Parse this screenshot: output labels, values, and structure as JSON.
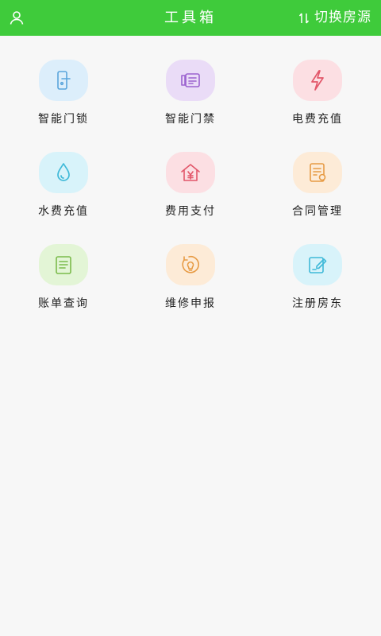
{
  "header": {
    "title": "工具箱",
    "switch_label": "切换房源",
    "background": "#3fcb3b"
  },
  "tools": [
    {
      "label": "智能门锁",
      "icon": "door-lock-icon",
      "bg": "#dceefb",
      "fg": "#5aa5dc"
    },
    {
      "label": "智能门禁",
      "icon": "access-card-icon",
      "bg": "#eadcf7",
      "fg": "#9b63cf"
    },
    {
      "label": "电费充值",
      "icon": "lightning-icon",
      "bg": "#fcdfe3",
      "fg": "#e2576a"
    },
    {
      "label": "水费充值",
      "icon": "water-drop-icon",
      "bg": "#d8f3fa",
      "fg": "#3fb9d8"
    },
    {
      "label": "费用支付",
      "icon": "house-yen-icon",
      "bg": "#fcdfe3",
      "fg": "#e2576a"
    },
    {
      "label": "合同管理",
      "icon": "contract-icon",
      "bg": "#fdebd7",
      "fg": "#e79b45"
    },
    {
      "label": "账单查询",
      "icon": "bill-icon",
      "bg": "#e3f5d6",
      "fg": "#7bbb4b"
    },
    {
      "label": "维修申报",
      "icon": "repair-bulb-icon",
      "bg": "#fdebd7",
      "fg": "#e79b45"
    },
    {
      "label": "注册房东",
      "icon": "register-edit-icon",
      "bg": "#d8f3fa",
      "fg": "#3fb9d8"
    }
  ]
}
